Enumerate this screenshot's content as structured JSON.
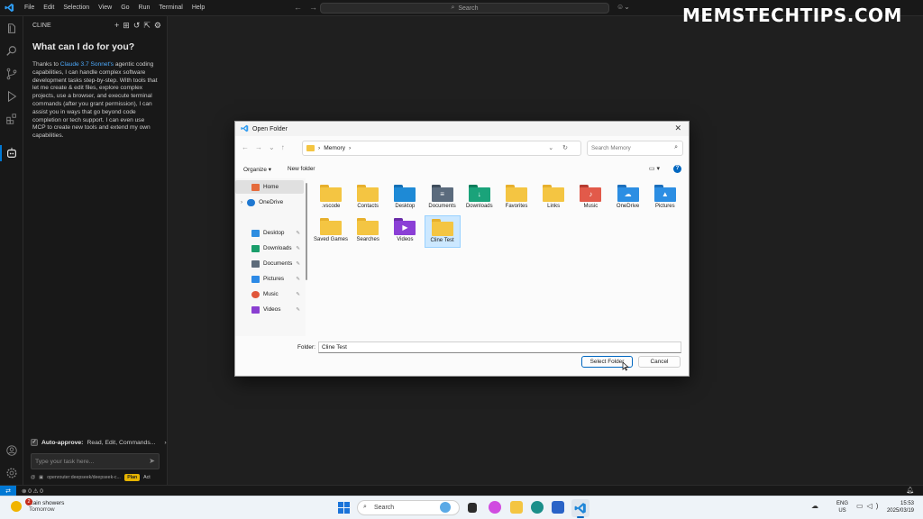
{
  "watermark": "MEMSTECHTIPS.COM",
  "titlebar": {
    "menu": [
      "File",
      "Edit",
      "Selection",
      "View",
      "Go",
      "Run",
      "Terminal",
      "Help"
    ],
    "search_label": "Search"
  },
  "cline": {
    "header": "CLINE",
    "heading": "What can I do for you?",
    "intro_pre": "Thanks to ",
    "intro_link": "Claude 3.7 Sonnet's",
    "intro_post": " agentic coding capabilities, I can handle complex software development tasks step-by-step. With tools that let me create & edit files, explore complex projects, use a browser, and execute terminal commands (after you grant permission), I can assist you in ways that go beyond code completion or tech support. I can even use MCP to create new tools and extend my own capabilities.",
    "auto_approve_label": "Auto-approve:",
    "auto_approve_value": "Read, Edit, Commands...",
    "task_placeholder": "Type your task here...",
    "model": "openrouter:deepseek/deepseek-c...",
    "plan_label": "Plan",
    "act_label": "Act"
  },
  "statusbar": {
    "problems": "⊗ 0 ⚠ 0"
  },
  "dialog": {
    "title": "Open Folder",
    "breadcrumb": "Memory",
    "search_placeholder": "Search Memory",
    "organize_label": "Organize ▾",
    "new_folder_label": "New folder",
    "nav": [
      {
        "label": "Home",
        "color": "#e56b3c",
        "pinned": false,
        "selected": true
      },
      {
        "label": "OneDrive",
        "color": "#1f78d1",
        "pinned": false,
        "selected": false
      },
      {
        "label": "Desktop",
        "color": "#2e8de0",
        "pinned": true,
        "selected": false
      },
      {
        "label": "Downloads",
        "color": "#1a9e6b",
        "pinned": true,
        "selected": false
      },
      {
        "label": "Documents",
        "color": "#5d6b7a",
        "pinned": true,
        "selected": false
      },
      {
        "label": "Pictures",
        "color": "#2d8ae6",
        "pinned": true,
        "selected": false
      },
      {
        "label": "Music",
        "color": "#e0563a",
        "pinned": true,
        "selected": false
      },
      {
        "label": "Videos",
        "color": "#8a3fd1",
        "pinned": true,
        "selected": false
      }
    ],
    "files": [
      {
        "name": ".vscode",
        "color": "#f4c542",
        "tab": "#e7b02d",
        "symbol": ""
      },
      {
        "name": "Contacts",
        "color": "#f4c542",
        "tab": "#e7b02d",
        "symbol": ""
      },
      {
        "name": "Desktop",
        "color": "#1e8ad6",
        "tab": "#1570b5",
        "symbol": ""
      },
      {
        "name": "Documents",
        "color": "#5b6b7d",
        "tab": "#3f4d5c",
        "symbol": "≡"
      },
      {
        "name": "Downloads",
        "color": "#1aa37a",
        "tab": "#0f7d5c",
        "symbol": "↓"
      },
      {
        "name": "Favorites",
        "color": "#f4c542",
        "tab": "#e7b02d",
        "symbol": ""
      },
      {
        "name": "Links",
        "color": "#f4c542",
        "tab": "#e7b02d",
        "symbol": ""
      },
      {
        "name": "Music",
        "color": "#e25a4a",
        "tab": "#b63c31",
        "symbol": "♪"
      },
      {
        "name": "OneDrive",
        "color": "#2c8ee3",
        "tab": "#1c6fbc",
        "symbol": "☁"
      },
      {
        "name": "Pictures",
        "color": "#2c8ee3",
        "tab": "#1c6fbc",
        "symbol": "▲"
      },
      {
        "name": "Saved Games",
        "color": "#f4c542",
        "tab": "#e7b02d",
        "symbol": ""
      },
      {
        "name": "Searches",
        "color": "#f4c542",
        "tab": "#e7b02d",
        "symbol": ""
      },
      {
        "name": "Videos",
        "color": "#8b3fd6",
        "tab": "#6a2ca8",
        "symbol": "▶"
      },
      {
        "name": "Cline Test",
        "color": "#f4c542",
        "tab": "#e7b02d",
        "symbol": "",
        "selected": true
      }
    ],
    "folder_label": "Folder:",
    "folder_value": "Cline Test",
    "select_button": "Select Folder",
    "cancel_button": "Cancel"
  },
  "taskbar": {
    "weather_badge": "2",
    "weather_line1": "Rain showers",
    "weather_line2": "Tomorrow",
    "search_label": "Search",
    "lang_line1": "ENG",
    "lang_line2": "US",
    "time": "15:53",
    "date": "2025/03/19"
  }
}
